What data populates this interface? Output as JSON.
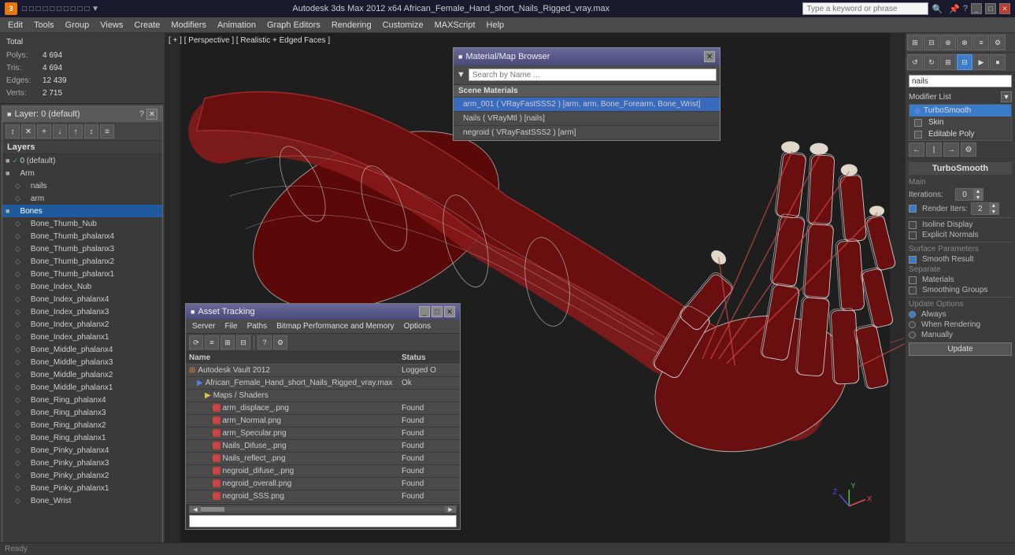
{
  "app": {
    "title": "Autodesk 3ds Max 2012 x64",
    "file": "African_Female_Hand_short_Nails_Rigged_vray.max",
    "full_title": "Autodesk 3ds Max 2012 x64  African_Female_Hand_short_Nails_Rigged_vray.max",
    "icon": "3ds"
  },
  "title_bar": {
    "search_placeholder": "Type a keyword or phrase",
    "window_buttons": [
      "_",
      "□",
      "✕"
    ]
  },
  "menu_bar": {
    "items": [
      "Edit",
      "Tools",
      "Group",
      "Views",
      "Create",
      "Modifiers",
      "Animation",
      "Graph Editors",
      "Rendering",
      "Customize",
      "MAXScript",
      "Help"
    ]
  },
  "viewport": {
    "label": "[ + ] [ Perspective ] [ Realistic + Edged Faces ]",
    "stats": {
      "total_label": "Total",
      "polys_label": "Polys:",
      "polys_val": "4 694",
      "tris_label": "Tris:",
      "tris_val": "4 694",
      "edges_label": "Edges:",
      "edges_val": "12 439",
      "verts_label": "Verts:",
      "verts_val": "2 715"
    }
  },
  "layer_dialog": {
    "title": "Layer: 0 (default)",
    "question_mark": "?",
    "close": "✕",
    "toolbar_tools": [
      "↕",
      "✕",
      "+",
      "↓",
      "↑",
      "↕",
      "≡"
    ],
    "header": "Layers",
    "layers": [
      {
        "name": "0 (default)",
        "indent": 0,
        "checked": true,
        "icon": "□"
      },
      {
        "name": "Arm",
        "indent": 0,
        "checked": false,
        "icon": "□"
      },
      {
        "name": "nails",
        "indent": 1,
        "checked": false,
        "icon": "◇"
      },
      {
        "name": "arm",
        "indent": 1,
        "checked": false,
        "icon": "◇"
      },
      {
        "name": "Bones",
        "indent": 0,
        "checked": false,
        "icon": "□",
        "selected": true
      },
      {
        "name": "Bone_Thumb_Nub",
        "indent": 1,
        "checked": false,
        "icon": "◇"
      },
      {
        "name": "Bone_Thumb_phalanx4",
        "indent": 1,
        "checked": false,
        "icon": "◇"
      },
      {
        "name": "Bone_Thumb_phalanx3",
        "indent": 1,
        "checked": false,
        "icon": "◇"
      },
      {
        "name": "Bone_Thumb_phalanx2",
        "indent": 1,
        "checked": false,
        "icon": "◇"
      },
      {
        "name": "Bone_Thumb_phalanx1",
        "indent": 1,
        "checked": false,
        "icon": "◇"
      },
      {
        "name": "Bone_Index_Nub",
        "indent": 1,
        "checked": false,
        "icon": "◇"
      },
      {
        "name": "Bone_Index_phalanx4",
        "indent": 1,
        "checked": false,
        "icon": "◇"
      },
      {
        "name": "Bone_Index_phalanx3",
        "indent": 1,
        "checked": false,
        "icon": "◇"
      },
      {
        "name": "Bone_Index_phalanx2",
        "indent": 1,
        "checked": false,
        "icon": "◇"
      },
      {
        "name": "Bone_Index_phalanx1",
        "indent": 1,
        "checked": false,
        "icon": "◇"
      },
      {
        "name": "Bone_Middle_phalanx4",
        "indent": 1,
        "checked": false,
        "icon": "◇"
      },
      {
        "name": "Bone_Middle_phalanx3",
        "indent": 1,
        "checked": false,
        "icon": "◇"
      },
      {
        "name": "Bone_Middle_phalanx2",
        "indent": 1,
        "checked": false,
        "icon": "◇"
      },
      {
        "name": "Bone_Middle_phalanx1",
        "indent": 1,
        "checked": false,
        "icon": "◇"
      },
      {
        "name": "Bone_Ring_phalanx4",
        "indent": 1,
        "checked": false,
        "icon": "◇"
      },
      {
        "name": "Bone_Ring_phalanx3",
        "indent": 1,
        "checked": false,
        "icon": "◇"
      },
      {
        "name": "Bone_Ring_phalanx2",
        "indent": 1,
        "checked": false,
        "icon": "◇"
      },
      {
        "name": "Bone_Ring_phalanx1",
        "indent": 1,
        "checked": false,
        "icon": "◇"
      },
      {
        "name": "Bone_Pinky_phalanx4",
        "indent": 1,
        "checked": false,
        "icon": "◇"
      },
      {
        "name": "Bone_Pinky_phalanx3",
        "indent": 1,
        "checked": false,
        "icon": "◇"
      },
      {
        "name": "Bone_Pinky_phalanx2",
        "indent": 1,
        "checked": false,
        "icon": "◇"
      },
      {
        "name": "Bone_Pinky_phalanx1",
        "indent": 1,
        "checked": false,
        "icon": "◇"
      },
      {
        "name": "Bone_Wrist",
        "indent": 1,
        "checked": false,
        "icon": "◇"
      }
    ]
  },
  "right_panel": {
    "search_input": "nails",
    "modifier_list_label": "Modifier List",
    "modifiers": [
      {
        "name": "TurboSmooth",
        "selected": true,
        "color": "#5080e0"
      },
      {
        "name": "Skin",
        "selected": false,
        "color": "#888"
      },
      {
        "name": "Editable Poly",
        "selected": false,
        "color": "#888"
      }
    ],
    "turbosmooth": {
      "title": "TurboSmooth",
      "main_label": "Main",
      "iterations_label": "Iterations:",
      "iterations_val": "0",
      "render_iters_label": "Render Iters:",
      "render_iters_val": "2",
      "isoline_label": "Isoline Display",
      "explicit_label": "Explicit Normals",
      "surface_params_label": "Surface Parameters",
      "smooth_result_label": "Smooth Result",
      "separate_label": "Separate",
      "materials_label": "Materials",
      "smoothing_label": "Smoothing Groups",
      "update_label": "Update Options",
      "always_label": "Always",
      "when_rendering_label": "When Rendering",
      "manually_label": "Manually",
      "update_btn": "Update"
    }
  },
  "material_browser": {
    "title": "Material/Map Browser",
    "search_placeholder": "Search by Name ...",
    "scene_materials_label": "Scene Materials",
    "materials": [
      {
        "name": "arm_001 ( VRayFastSSS2 ) [arm, arm, Bone_Forearm, Bone_Wrist]"
      },
      {
        "name": "Nails ( VRayMtl ) [nails]"
      },
      {
        "name": "negroid ( VRayFastSSS2 ) [arm]"
      }
    ]
  },
  "asset_tracking": {
    "title": "Asset Tracking",
    "menu_items": [
      "Server",
      "File",
      "Paths",
      "Bitmap Performance and Memory",
      "Options"
    ],
    "toolbar_btns": [
      "⟳",
      "≡",
      "⊞",
      "⊟"
    ],
    "columns": {
      "name": "Name",
      "status": "Status"
    },
    "rows": [
      {
        "name": "Autodesk Vault 2012",
        "status": "Logged O",
        "icon": "vault",
        "indent": 0,
        "type": "vault"
      },
      {
        "name": "African_Female_Hand_short_Nails_Rigged_vray.max",
        "status": "Ok",
        "icon": "file",
        "indent": 1,
        "type": "file"
      },
      {
        "name": "Maps / Shaders",
        "status": "",
        "icon": "folder",
        "indent": 2,
        "type": "folder"
      },
      {
        "name": "arm_displace_.png",
        "status": "Found",
        "icon": "map",
        "indent": 3,
        "type": "map"
      },
      {
        "name": "arm_Normal.png",
        "status": "Found",
        "icon": "map",
        "indent": 3,
        "type": "map"
      },
      {
        "name": "arm_Specular.png",
        "status": "Found",
        "icon": "map",
        "indent": 3,
        "type": "map"
      },
      {
        "name": "Nails_Difuse_.png",
        "status": "Found",
        "icon": "map",
        "indent": 3,
        "type": "map"
      },
      {
        "name": "Nails_reflect_.png",
        "status": "Found",
        "icon": "map",
        "indent": 3,
        "type": "map"
      },
      {
        "name": "negroid_difuse_.png",
        "status": "Found",
        "icon": "map",
        "indent": 3,
        "type": "map"
      },
      {
        "name": "negroid_overall.png",
        "status": "Found",
        "icon": "map",
        "indent": 3,
        "type": "map"
      },
      {
        "name": "negroid_SSS.png",
        "status": "Found",
        "icon": "map",
        "indent": 3,
        "type": "map"
      }
    ]
  }
}
